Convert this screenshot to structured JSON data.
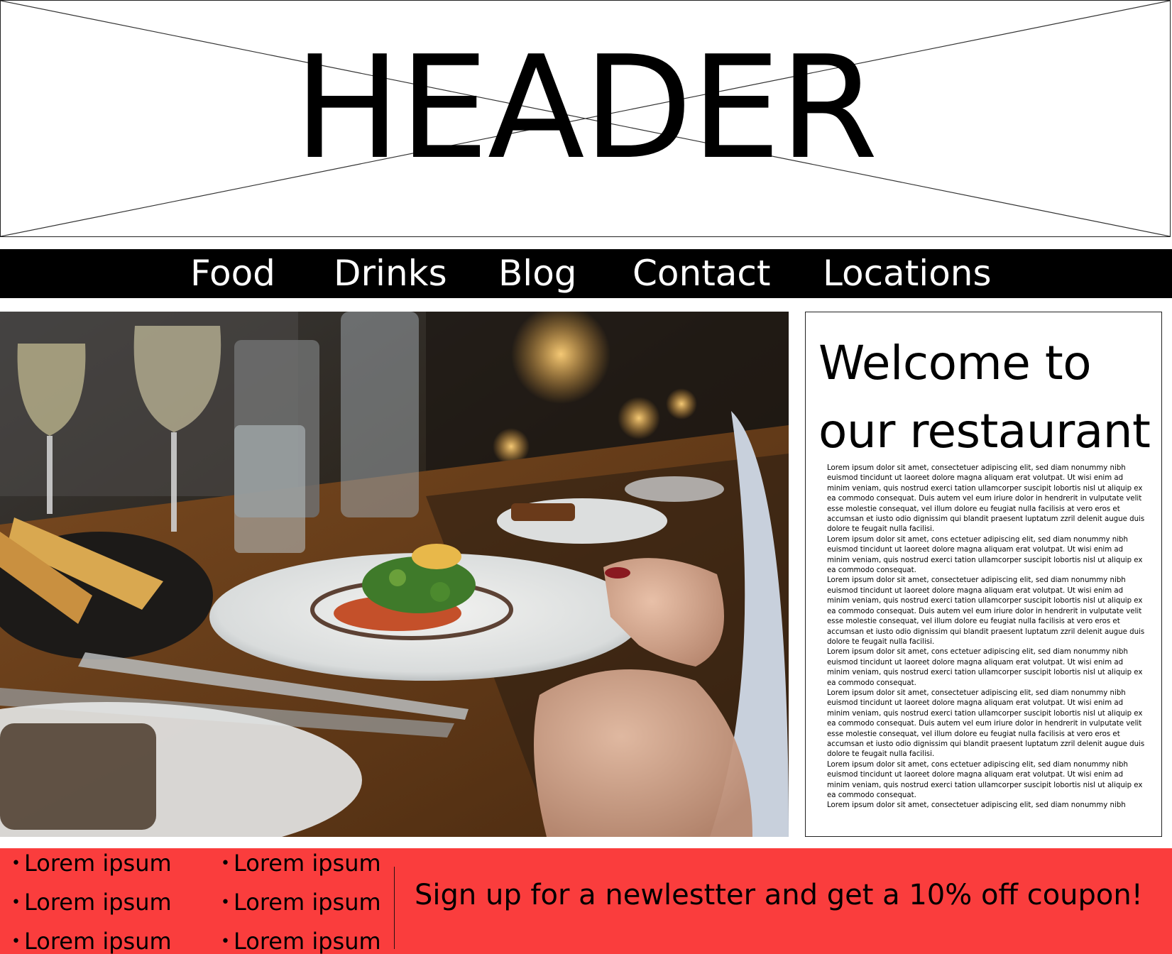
{
  "header": {
    "title": "HEADER"
  },
  "nav": {
    "items": [
      {
        "label": "Food"
      },
      {
        "label": "Drinks"
      },
      {
        "label": "Blog"
      },
      {
        "label": "Contact"
      },
      {
        "label": "Locations"
      }
    ]
  },
  "hero": {
    "image_icon": "restaurant-dinner-photo"
  },
  "welcome": {
    "title_line1": "Welcome to",
    "title_line2": "our restaurant",
    "paragraphs": [
      "Lorem ipsum dolor sit amet, consectetuer adipiscing elit, sed diam nonummy nibh euismod tincidunt ut laoreet dolore magna aliquam erat volutpat. Ut wisi enim ad minim veniam, quis nostrud exerci tation ullamcorper suscipit lobortis nisl ut aliquip ex ea commodo consequat. Duis autem vel eum iriure dolor in hendrerit in vulputate velit esse molestie consequat, vel illum dolore eu feugiat nulla facilisis at vero eros et accumsan et iusto odio dignissim qui blandit praesent luptatum zzril delenit augue duis dolore te feugait nulla facilisi.",
      "Lorem ipsum dolor sit amet, cons ectetuer adipiscing elit, sed diam nonummy nibh euismod tincidunt ut laoreet dolore magna aliquam erat volutpat. Ut wisi enim ad minim veniam, quis nostrud exerci tation ullamcorper suscipit lobortis nisl ut aliquip ex ea commodo consequat.",
      "Lorem ipsum dolor sit amet, consectetuer adipiscing elit, sed diam nonummy nibh euismod tincidunt ut laoreet dolore magna aliquam erat volutpat. Ut wisi enim ad minim veniam, quis nostrud exerci tation ullamcorper suscipit lobortis nisl ut aliquip ex ea commodo consequat. Duis autem vel eum iriure dolor in hendrerit in vulputate velit esse molestie consequat, vel illum dolore eu feugiat nulla facilisis at vero eros et accumsan et iusto odio dignissim qui blandit praesent luptatum zzril delenit augue duis dolore te feugait nulla facilisi.",
      "Lorem ipsum dolor sit amet, cons ectetuer adipiscing elit, sed diam nonummy nibh euismod tincidunt ut laoreet dolore magna aliquam erat volutpat. Ut wisi enim ad minim veniam, quis nostrud exerci tation ullamcorper suscipit lobortis nisl ut aliquip ex ea commodo consequat.",
      "Lorem ipsum dolor sit amet, consectetuer adipiscing elit, sed diam nonummy nibh euismod tincidunt ut laoreet dolore magna aliquam erat volutpat. Ut wisi enim ad minim veniam, quis nostrud exerci tation ullamcorper suscipit lobortis nisl ut aliquip ex ea commodo consequat. Duis autem vel eum iriure dolor in hendrerit in vulputate velit esse molestie consequat, vel illum dolore eu feugiat nulla facilisis at vero eros et accumsan et iusto odio dignissim qui blandit praesent luptatum zzril delenit augue duis dolore te feugait nulla facilisi.",
      "Lorem ipsum dolor sit amet, cons ectetuer adipiscing elit, sed diam nonummy nibh euismod tincidunt ut laoreet dolore magna aliquam erat volutpat. Ut wisi enim ad minim veniam, quis nostrud exerci tation ullamcorper suscipit lobortis nisl ut aliquip ex ea commodo consequat.",
      "Lorem ipsum dolor sit amet, consectetuer adipiscing elit, sed diam nonummy nibh"
    ]
  },
  "footer": {
    "bullet": "•",
    "list_left": [
      "Lorem ipsum",
      "Lorem ipsum",
      "Lorem ipsum"
    ],
    "list_right": [
      "Lorem ipsum",
      "Lorem ipsum",
      "Lorem ipsum"
    ],
    "cta": "Sign up for a newlestter and get a 10% off coupon!"
  },
  "colors": {
    "nav_bg": "#000000",
    "nav_text": "#ffffff",
    "footer_bg": "#fa3d3d",
    "border": "#222222"
  }
}
